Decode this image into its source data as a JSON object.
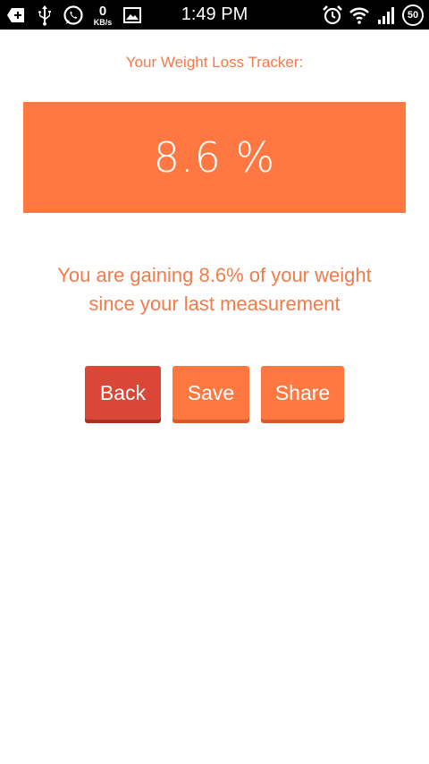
{
  "status_bar": {
    "time": "1:49 PM",
    "network_speed_value": "0",
    "network_speed_unit": "KB/s",
    "battery_level": "50",
    "icons": [
      "add-notification-icon",
      "usb-icon",
      "whatsapp-icon",
      "image-icon",
      "alarm-icon",
      "wifi-icon",
      "signal-icon",
      "battery-icon"
    ]
  },
  "screen": {
    "title": "Your Weight Loss Tracker:",
    "percent_display": "8.6 %",
    "message_line1": "You are gaining 8.6% of your weight",
    "message_line2": "since your last measurement"
  },
  "buttons": {
    "back_label": "Back",
    "save_label": "Save",
    "share_label": "Share"
  },
  "colors": {
    "accent": "#ff7842",
    "back_button": "#d94836",
    "text_accent": "#f47a4a"
  }
}
